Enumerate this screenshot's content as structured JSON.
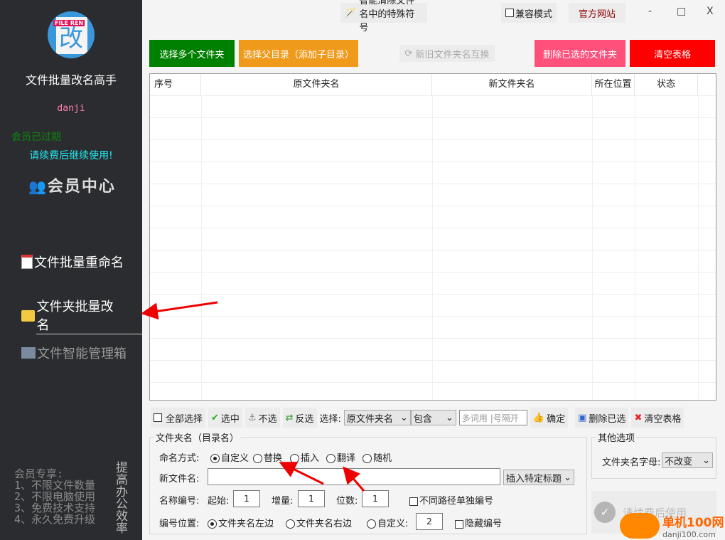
{
  "sidebar": {
    "logo_tag": "FILE REN",
    "logo_char": "改",
    "app_title": "文件批量改名高手",
    "username": "danji",
    "membership_status": "会员已过期",
    "renew_text": "请续费后继续使用!",
    "vip_center": "会员中心",
    "nav": [
      {
        "label": "文件批量重命名",
        "icon": "document-icon"
      },
      {
        "label": "文件夹批量改名",
        "icon": "folder-icon",
        "active": true
      },
      {
        "label": "文件智能管理箱",
        "icon": "toolbox-icon"
      }
    ],
    "perks_title": "会员专享:",
    "perks": [
      "1、不限文件数量",
      "2、不限电脑使用",
      "3、免费技术支持",
      "4、永久免费升级"
    ],
    "slogan": "提高办公效率"
  },
  "topbar": {
    "clean_symbols": "智能清除文件名中的特殊符号",
    "compat_mode": "兼容模式",
    "official_site": "官方网站",
    "minimize": "-",
    "maximize": "□",
    "close": "X"
  },
  "actions": {
    "select_folders": "选择多个文件夹",
    "select_dir": "选择父目录（添加子目录）",
    "swap_names": "新旧文件夹名互换",
    "delete_selected": "删除已选的文件夹",
    "clear_table": "清空表格"
  },
  "colors": {
    "green": "#008000",
    "orange": "#f09a1c",
    "pink": "#ff4f7b",
    "red": "#ff0000",
    "sidebar": "#2b2c30"
  },
  "table": {
    "columns": [
      "序号",
      "原文件夹名",
      "新文件夹名",
      "所在位置",
      "状态"
    ],
    "rows": []
  },
  "toolbar": {
    "select_all": "全部选择",
    "check": "选中",
    "uncheck": "不选",
    "invert": "反选",
    "select_label": "选择:",
    "field": "原文件夹名",
    "match": "包含",
    "keyword_placeholder": "多词用 |号隔开",
    "confirm": "确定",
    "delete_selected": "删除已选",
    "clear_table": "清空表格"
  },
  "naming": {
    "group_title": "文件夹名（目录名）",
    "mode_label": "命名方式:",
    "modes": [
      "自定义",
      "替换",
      "插入",
      "翻译",
      "随机"
    ],
    "selected_mode": "自定义",
    "new_name_label": "新文件名:",
    "new_name_value": "",
    "insert_title": "插入特定标题",
    "number_label": "名称编号:",
    "start_label": "起始:",
    "start": "1",
    "step_label": "增量:",
    "step": "1",
    "digits_label": "位数:",
    "digits": "1",
    "separate_numbering": "不同路径单独编号",
    "position_label": "编号位置:",
    "positions": [
      "文件夹名左边",
      "文件夹名右边",
      "自定义:"
    ],
    "selected_position": "文件夹名左边",
    "custom_pos": "2",
    "hide_number": "隐藏编号"
  },
  "other": {
    "group_title": "其他选项",
    "case_label": "文件夹名字母:",
    "case_value": "不改变",
    "run_disabled": "请续费后使用"
  },
  "watermark": {
    "site": "单机100网",
    "url": "danji100.com"
  }
}
